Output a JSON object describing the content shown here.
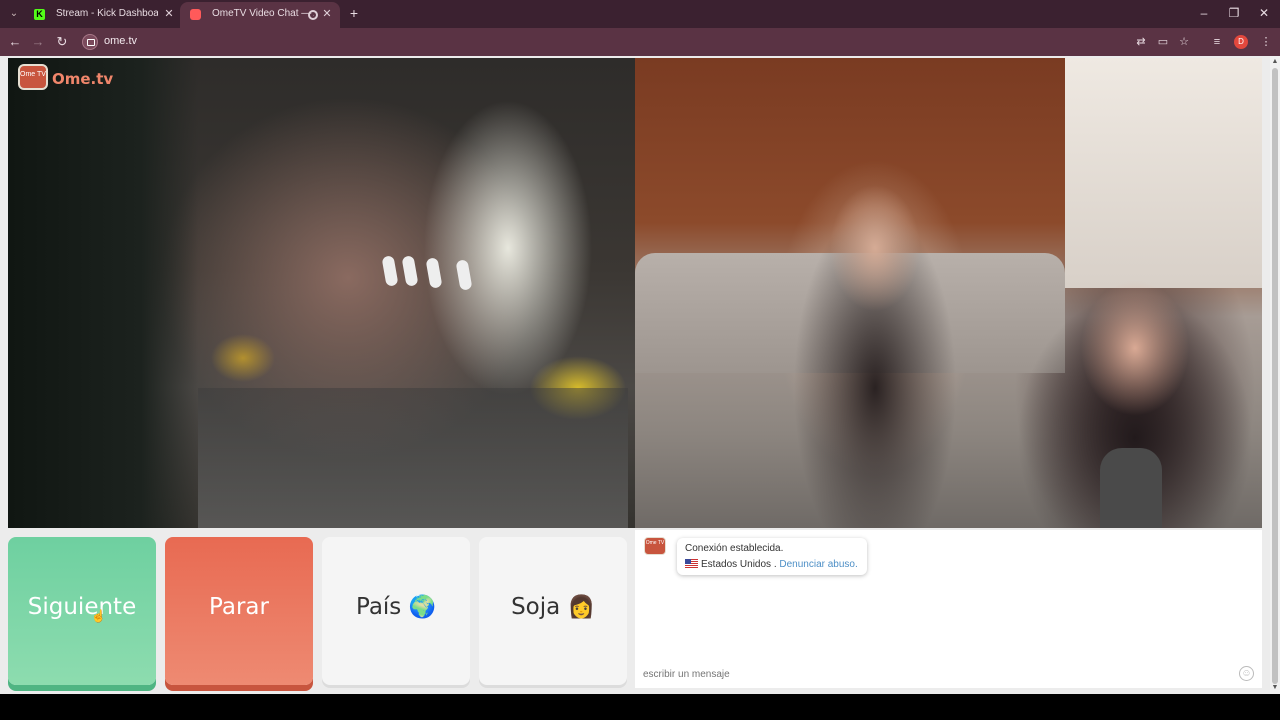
{
  "browser": {
    "tabs": [
      {
        "label": "Stream - Kick Dashboard",
        "icon": "kick-icon"
      },
      {
        "label": "OmeTV Video Chat — Alte",
        "icon": "ometv-icon"
      }
    ],
    "url": "ome.tv",
    "kick_letter": "K",
    "profile_letter": "D"
  },
  "brand": {
    "name": "Ome.tv",
    "badge": "Ome TV"
  },
  "controls": {
    "next_label": "Siguiente",
    "stop_label": "Parar",
    "country_label": "País",
    "country_emoji": "🌍",
    "gender_label": "Soja",
    "gender_emoji": "👩"
  },
  "chat": {
    "status": "Conexión establecida.",
    "country": "Estados Unidos .",
    "report_link": "Denunciar abuso.",
    "placeholder": "escribir un mensaje"
  },
  "colors": {
    "next": "#6ed0a0",
    "stop": "#e86a52",
    "tab_bar": "#3b2130",
    "address_bar": "#5a3344"
  }
}
